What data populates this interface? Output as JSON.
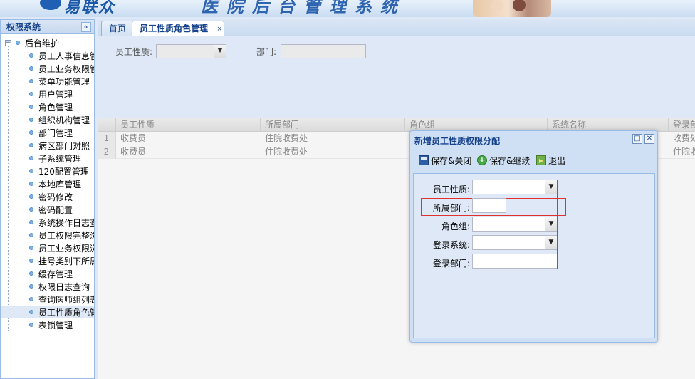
{
  "header": {
    "logo_text": "易联众",
    "banner_title": "医院后台管理系统"
  },
  "left_panel": {
    "title": "权限系统",
    "collapse_label": "«",
    "root_label": "后台维护",
    "items": [
      {
        "label": "员工人事信息管",
        "selected": false
      },
      {
        "label": "员工业务权限管",
        "selected": false
      },
      {
        "label": "菜单功能管理",
        "selected": false
      },
      {
        "label": "用户管理",
        "selected": false
      },
      {
        "label": "角色管理",
        "selected": false
      },
      {
        "label": "组织机构管理",
        "selected": false
      },
      {
        "label": "部门管理",
        "selected": false
      },
      {
        "label": "病区部门对照",
        "selected": false
      },
      {
        "label": "子系统管理",
        "selected": false
      },
      {
        "label": "120配置管理",
        "selected": false
      },
      {
        "label": "本地库管理",
        "selected": false
      },
      {
        "label": "密码修改",
        "selected": false
      },
      {
        "label": "密码配置",
        "selected": false
      },
      {
        "label": "系统操作日志查",
        "selected": false
      },
      {
        "label": "员工权限完整浏",
        "selected": false
      },
      {
        "label": "员工业务权限浏",
        "selected": false
      },
      {
        "label": "挂号类别下所属",
        "selected": false
      },
      {
        "label": "缓存管理",
        "selected": false
      },
      {
        "label": "权限日志查询",
        "selected": false
      },
      {
        "label": "查询医师组列表",
        "selected": false
      },
      {
        "label": "员工性质角色管",
        "selected": true
      },
      {
        "label": "表锁管理",
        "selected": false
      }
    ]
  },
  "tabs": [
    {
      "label": "首页",
      "active": false
    },
    {
      "label": "员工性质角色管理",
      "active": true,
      "close": "×"
    }
  ],
  "filter": {
    "nature_label": "员工性质:",
    "dept_label": "部门:",
    "nature_value": "",
    "dept_value": ""
  },
  "grid": {
    "columns": [
      "员工性质",
      "所属部门",
      "角色组",
      "系统名称",
      "登录部"
    ],
    "rows": [
      {
        "num": "1",
        "cells": [
          "收费员",
          "住院收费处",
          "",
          "",
          "收费处"
        ]
      },
      {
        "num": "2",
        "cells": [
          "收费员",
          "住院收费处",
          "",
          "",
          "住院收"
        ]
      }
    ]
  },
  "dialog": {
    "title": "新增员工性质权限分配",
    "toolbar": {
      "save_close": "保存&关闭",
      "save_continue": "保存&继续",
      "exit": "退出"
    },
    "fields": [
      {
        "label": "员工性质:",
        "value": "",
        "type": "select"
      },
      {
        "label": "所属部门:",
        "value": "",
        "type": "input"
      },
      {
        "label": "角色组:",
        "value": "",
        "type": "select"
      },
      {
        "label": "登录系统:",
        "value": "",
        "type": "select"
      },
      {
        "label": "登录部门:",
        "value": "",
        "type": "input"
      }
    ]
  }
}
